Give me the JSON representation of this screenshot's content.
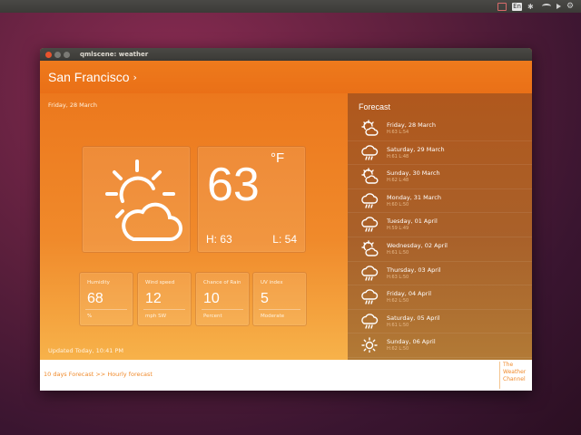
{
  "window": {
    "title": "qmlscene: weather"
  },
  "header": {
    "city": "San Francisco",
    "chevron": "›"
  },
  "main": {
    "date": "Friday, 28 March",
    "temperature": "63",
    "unit": "°F",
    "high": "H: 63",
    "low": "L: 54",
    "updated": "Updated Today, 10:41 PM",
    "current_icon": "partly-cloudy-icon"
  },
  "stats": [
    {
      "label": "Humidity",
      "value": "68",
      "unit": "%"
    },
    {
      "label": "Wind speed",
      "value": "12",
      "unit": "mph SW"
    },
    {
      "label": "Chance of Rain",
      "value": "10",
      "unit": "Percent"
    },
    {
      "label": "UV index",
      "value": "5",
      "unit": "Moderate"
    }
  ],
  "forecast": {
    "title": "Forecast",
    "items": [
      {
        "day": "Friday, 28 March",
        "hl": "H:63 L:54",
        "icon": "partly-cloudy-icon"
      },
      {
        "day": "Saturday, 29 March",
        "hl": "H:61 L:48",
        "icon": "rain-cloud-icon"
      },
      {
        "day": "Sunday, 30 March",
        "hl": "H:62 L:48",
        "icon": "partly-cloudy-icon"
      },
      {
        "day": "Monday, 31 March",
        "hl": "H:60 L:50",
        "icon": "rain-cloud-icon"
      },
      {
        "day": "Tuesday, 01 April",
        "hl": "H:59 L:49",
        "icon": "rain-cloud-icon"
      },
      {
        "day": "Wednesday, 02 April",
        "hl": "H:61 L:50",
        "icon": "partly-cloudy-icon"
      },
      {
        "day": "Thursday, 03 April",
        "hl": "H:63 L:50",
        "icon": "rain-cloud-icon"
      },
      {
        "day": "Friday, 04 April",
        "hl": "H:62 L:50",
        "icon": "rain-cloud-icon"
      },
      {
        "day": "Saturday, 05 April",
        "hl": "H:61 L:50",
        "icon": "rain-cloud-icon"
      },
      {
        "day": "Sunday, 06 April",
        "hl": "H:62 L:50",
        "icon": "sun-icon"
      }
    ]
  },
  "footer": {
    "link_10day": "10 days Forecast",
    "separator": ">>",
    "link_hourly": "Hourly forecast",
    "brand_line1": "The",
    "brand_line2": "Weather",
    "brand_line3": "Channel"
  },
  "colors": {
    "accent": "#f08a2b",
    "header": "#ea7017",
    "sidebar": "#a9612a"
  }
}
